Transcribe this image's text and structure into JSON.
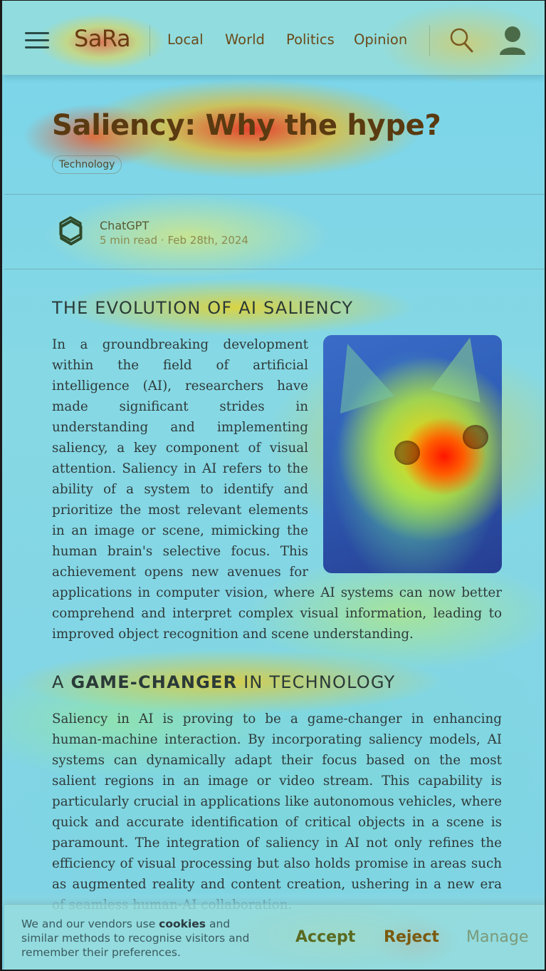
{
  "header": {
    "brand": "SaRa",
    "nav": [
      "Local",
      "World",
      "Politics",
      "Opinion"
    ]
  },
  "article": {
    "title": "Saliency: Why the hype?",
    "tag": "Technology",
    "author": {
      "name": "ChatGPT",
      "meta": "5 min read · Feb 28th, 2024"
    },
    "sections": [
      {
        "heading_parts": [
          "THE EVOLUTION OF AI SALIENCY"
        ],
        "body": "In a groundbreaking development within the field of artificial intelligence (AI), researchers have made significant strides in understanding and implementing saliency, a key component of visual attention. Saliency in AI refers to the ability of a system to identify and prioritize the most relevant elements in an image or scene, mimicking the human brain's selective focus. This achievement opens new avenues for applications in computer vision, where AI systems can now better comprehend and interpret complex visual information, leading to improved object recognition and scene understanding."
      },
      {
        "heading_parts": [
          "A ",
          "GAME-CHANGER",
          " IN TECHNOLOGY"
        ],
        "body": "Saliency in AI is proving to be a game-changer in enhancing human-machine interaction. By incorporating saliency models, AI systems can dynamically adapt their focus based on the most salient regions in an image or video stream. This capability is particularly crucial in applications like autonomous vehicles, where quick and accurate identification of critical objects in a scene is paramount. The integration of saliency in AI not only refines the efficiency of visual processing but also holds promise in areas such as augmented reality and content creation, ushering in a new era of seamless human-AI collaboration."
      }
    ]
  },
  "cookie_banner": {
    "text_before": "We and our vendors use ",
    "text_bold": "cookies",
    "text_after": " and similar methods to recognise visitors and remember their preferences.",
    "accept": "Accept",
    "reject": "Reject",
    "manage": "Manage"
  },
  "colors": {
    "brand": "#6b3a10",
    "accept": "#5a6a20",
    "reject": "#7a5a10",
    "manage": "#7a9a7a"
  },
  "icons": [
    "menu-icon",
    "search-icon",
    "user-icon",
    "openai-logo-icon"
  ]
}
